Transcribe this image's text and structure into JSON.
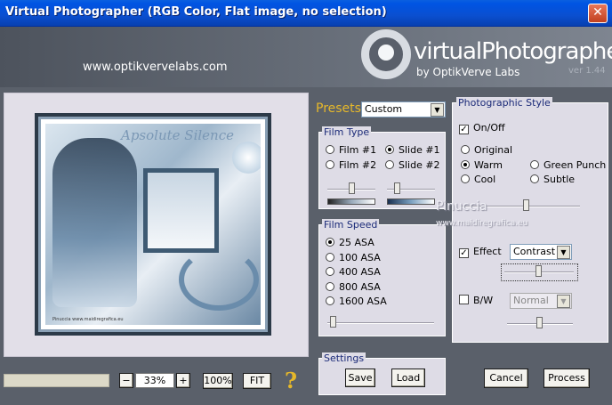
{
  "window": {
    "title": "Virtual Photographer (RGB Color, Flat image, no selection)",
    "close_glyph": "✕"
  },
  "header": {
    "url": "www.optikvervelabs.com",
    "logo_title": "virtualPhotographer",
    "logo_subtitle": "by OptikVerve Labs",
    "version": "ver 1.44"
  },
  "preview": {
    "artwork_title": "Apsolute Silence",
    "signature": "Pinuccia www.maidiregrafica.eu"
  },
  "zoom": {
    "minus_label": "−",
    "value": "33%",
    "plus_label": "+",
    "hundred_label": "100%",
    "fit_label": "FIT",
    "help_label": "?"
  },
  "presets": {
    "label": "Presets",
    "selected": "Custom"
  },
  "film_type": {
    "legend": "Film Type",
    "options": [
      {
        "label": "Film #1",
        "selected": false
      },
      {
        "label": "Slide #1",
        "selected": true
      },
      {
        "label": "Film #2",
        "selected": false
      },
      {
        "label": "Slide #2",
        "selected": false
      }
    ]
  },
  "film_speed": {
    "legend": "Film Speed",
    "options": [
      {
        "label": "25 ASA",
        "selected": true
      },
      {
        "label": "100 ASA",
        "selected": false
      },
      {
        "label": "400 ASA",
        "selected": false
      },
      {
        "label": "800 ASA",
        "selected": false
      },
      {
        "label": "1600 ASA",
        "selected": false
      }
    ]
  },
  "settings": {
    "legend": "Settings",
    "save_label": "Save",
    "load_label": "Load"
  },
  "photo_style": {
    "legend": "Photographic Style",
    "onoff_label": "On/Off",
    "onoff_checked": true,
    "styles": [
      {
        "label": "Original",
        "selected": false
      },
      {
        "label": "Warm",
        "selected": true
      },
      {
        "label": "Green Punch",
        "selected": false
      },
      {
        "label": "Cool",
        "selected": false
      },
      {
        "label": "Subtle",
        "selected": false
      }
    ],
    "effect_label": "Effect",
    "effect_checked": true,
    "effect_selected": "Contrast",
    "bw_label": "B/W",
    "bw_checked": false,
    "bw_selected": "Normal"
  },
  "watermark": {
    "name": "Pinuccia",
    "site": "www.maidiregrafica.eu"
  },
  "actions": {
    "cancel_label": "Cancel",
    "process_label": "Process"
  },
  "colors": {
    "accent_yellow": "#e6b82a",
    "legend_blue": "#1b2a78",
    "titlebar_blue": "#0054e3"
  }
}
